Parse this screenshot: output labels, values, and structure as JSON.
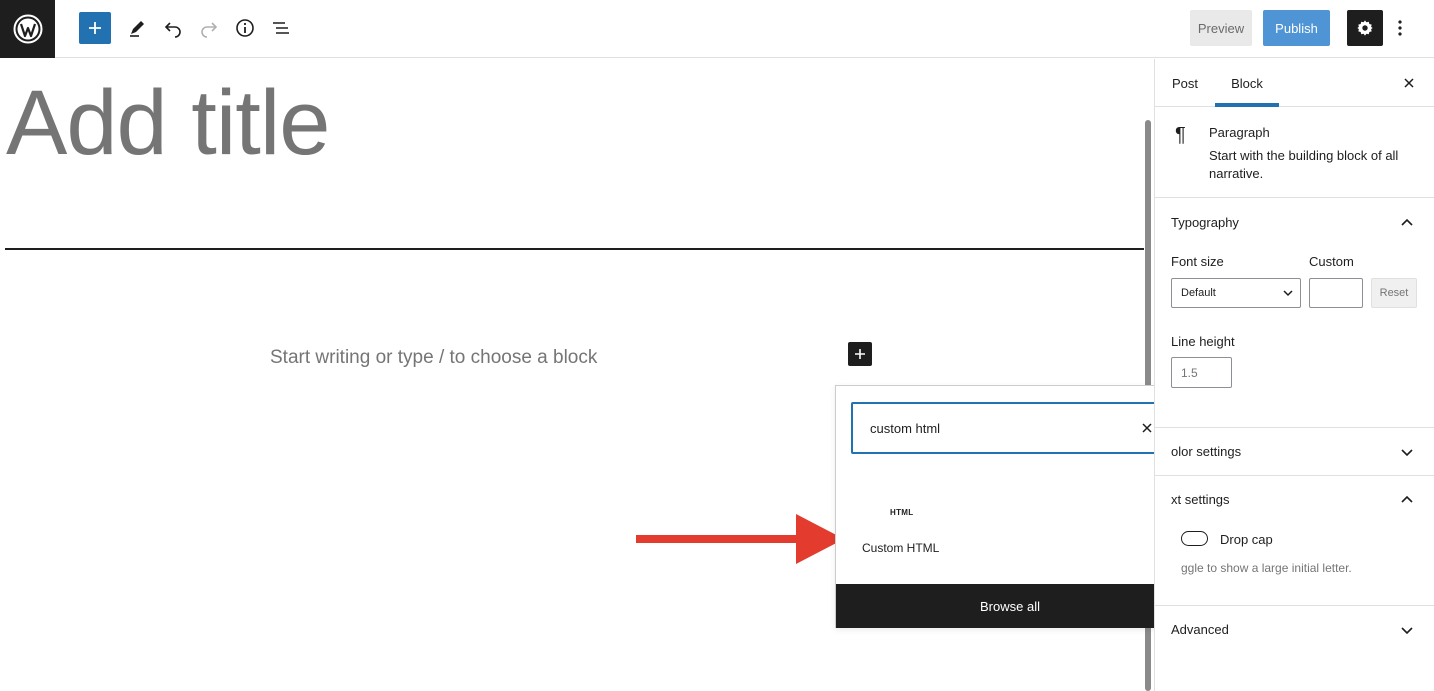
{
  "toolbar": {
    "preview_label": "Preview",
    "publish_label": "Publish"
  },
  "editor": {
    "title_placeholder": "Add title",
    "paragraph_placeholder": "Start writing or type / to choose a block"
  },
  "inserter": {
    "search_value": "custom html",
    "result_icon_text": "HTML",
    "result_label": "Custom HTML",
    "browse_all_label": "Browse all"
  },
  "sidebar": {
    "tabs": [
      {
        "label": "Post",
        "active": false
      },
      {
        "label": "Block",
        "active": true
      }
    ],
    "block": {
      "name": "Paragraph",
      "description": "Start with the building block of all narrative."
    },
    "typography": {
      "heading": "Typography",
      "font_size_label": "Font size",
      "font_size_value": "Default",
      "custom_label": "Custom",
      "reset_label": "Reset",
      "line_height_label": "Line height",
      "line_height_placeholder": "1.5"
    },
    "color_settings": {
      "heading": "olor settings"
    },
    "text_settings": {
      "heading": "xt settings",
      "drop_cap_label": "Drop cap",
      "drop_cap_help": "ggle to show a large initial letter."
    },
    "advanced": {
      "heading": "Advanced"
    }
  },
  "colors": {
    "accent": "#2271b1",
    "annotation_arrow": "#e33b2e"
  }
}
